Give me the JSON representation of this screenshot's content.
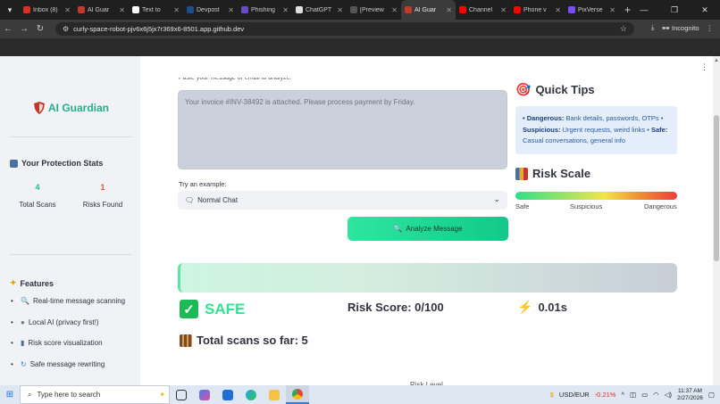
{
  "browser": {
    "tabs": [
      {
        "label": "Inbox (8)",
        "color": "#d93025",
        "active": false
      },
      {
        "label": "AI Guar",
        "color": "#c0392b",
        "active": false
      },
      {
        "label": "Text to",
        "color": "#ffffff",
        "active": false
      },
      {
        "label": "Devpost",
        "color": "#1a4f8b",
        "active": false
      },
      {
        "label": "Phishing",
        "color": "#6a4bc4",
        "active": false
      },
      {
        "label": "ChatGPT",
        "color": "#e0e0e0",
        "active": false
      },
      {
        "label": "[Preview",
        "color": "#555555",
        "active": false
      },
      {
        "label": "AI Guar",
        "color": "#c0392b",
        "active": true
      },
      {
        "label": "Channel",
        "color": "#ff0000",
        "active": false
      },
      {
        "label": "Phone v",
        "color": "#ff0000",
        "active": false
      },
      {
        "label": "PixVerse",
        "color": "#7b4dff",
        "active": false
      }
    ],
    "new_tab": "+",
    "url": "curly-space-robot-pjv6x6j5jx7r369x6-8501.app.github.dev",
    "incognito_label": "Incognito"
  },
  "sidebar": {
    "brand": "AI Guardian",
    "stats_heading": "Your Protection Stats",
    "stats": [
      {
        "value": "4",
        "label": "Total Scans",
        "color": "#21c07a"
      },
      {
        "value": "1",
        "label": "Risks Found",
        "color": "#e5533d"
      }
    ],
    "features_heading": "Features",
    "features": [
      {
        "icon": "magnifier-icon",
        "label": "Real-time message scanning"
      },
      {
        "icon": "lock-icon",
        "label": "Local AI (privacy first!)"
      },
      {
        "icon": "bar-chart-icon",
        "label": "Risk score visualization"
      },
      {
        "icon": "refresh-icon",
        "label": "Safe message rewriting"
      }
    ]
  },
  "main": {
    "cut_label": "Paste your message or email to analyze:",
    "message_text": "Your invoice #INV-38492 is attached. Please process payment by Friday.",
    "try_label": "Try an example:",
    "example_selected": "Normal Chat",
    "analyze_label": "Analyze Message",
    "result_label": "SAFE",
    "risk_score_label": "Risk Score: 0/100",
    "time_label": "0.01s",
    "total_scans_label": "Total scans so far: 5",
    "bottom_cut": "Risk Level"
  },
  "tips": {
    "title": "Quick Tips",
    "dangerous_label": "• Dangerous:",
    "dangerous_text": " Bank details, passwords, OTPs •",
    "suspicious_label": "Suspicious:",
    "suspicious_text": " Urgent requests, weird links •",
    "safe_label": " Safe:",
    "safe_text": "Casual conversations, general info"
  },
  "risk_scale": {
    "title": "Risk Scale",
    "labels": [
      "Safe",
      "Suspicious",
      "Dangerous"
    ]
  },
  "taskbar": {
    "search_placeholder": "Type here to search",
    "currency": "USD/EUR",
    "change": "-0.21%",
    "time": "11:37 AM",
    "date": "2/27/2026"
  }
}
